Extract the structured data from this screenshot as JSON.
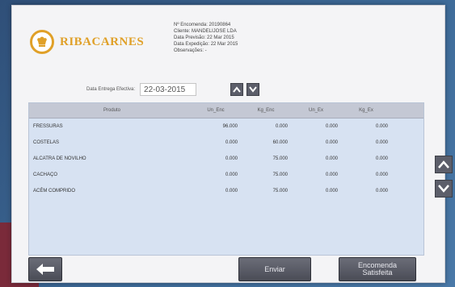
{
  "brand": {
    "name": "RIBACARNES"
  },
  "info_lines": [
    "Nº Encomenda: 20190864",
    "Cliente: MANDELIJOSE LDA",
    "Data Previsão: 22 Mar 2015",
    "Data Expedição: 22 Mar 2015",
    "Observações: -"
  ],
  "delivery": {
    "label": "Data Entrega Efectiva:",
    "value": "22-03-2015"
  },
  "table": {
    "columns": [
      "Produto",
      "Un_Enc",
      "Kg_Enc",
      "Un_Ex",
      "Kg_Ex"
    ],
    "rows": [
      [
        "FRESSURAS",
        "96.000",
        "0.000",
        "0.000",
        "0.000"
      ],
      [
        "COSTELAS",
        "0.000",
        "60.000",
        "0.000",
        "0.000"
      ],
      [
        "ALCATRA DE NOVILHO",
        "0.000",
        "75.000",
        "0.000",
        "0.000"
      ],
      [
        "CACHAÇO",
        "0.000",
        "75.000",
        "0.000",
        "0.000"
      ],
      [
        "ACÉM COMPRIDO",
        "0.000",
        "75.000",
        "0.000",
        "0.000"
      ]
    ]
  },
  "buttons": {
    "send": "Enviar",
    "order_line1": "Encomenda",
    "order_line2": "Satisfeita"
  }
}
